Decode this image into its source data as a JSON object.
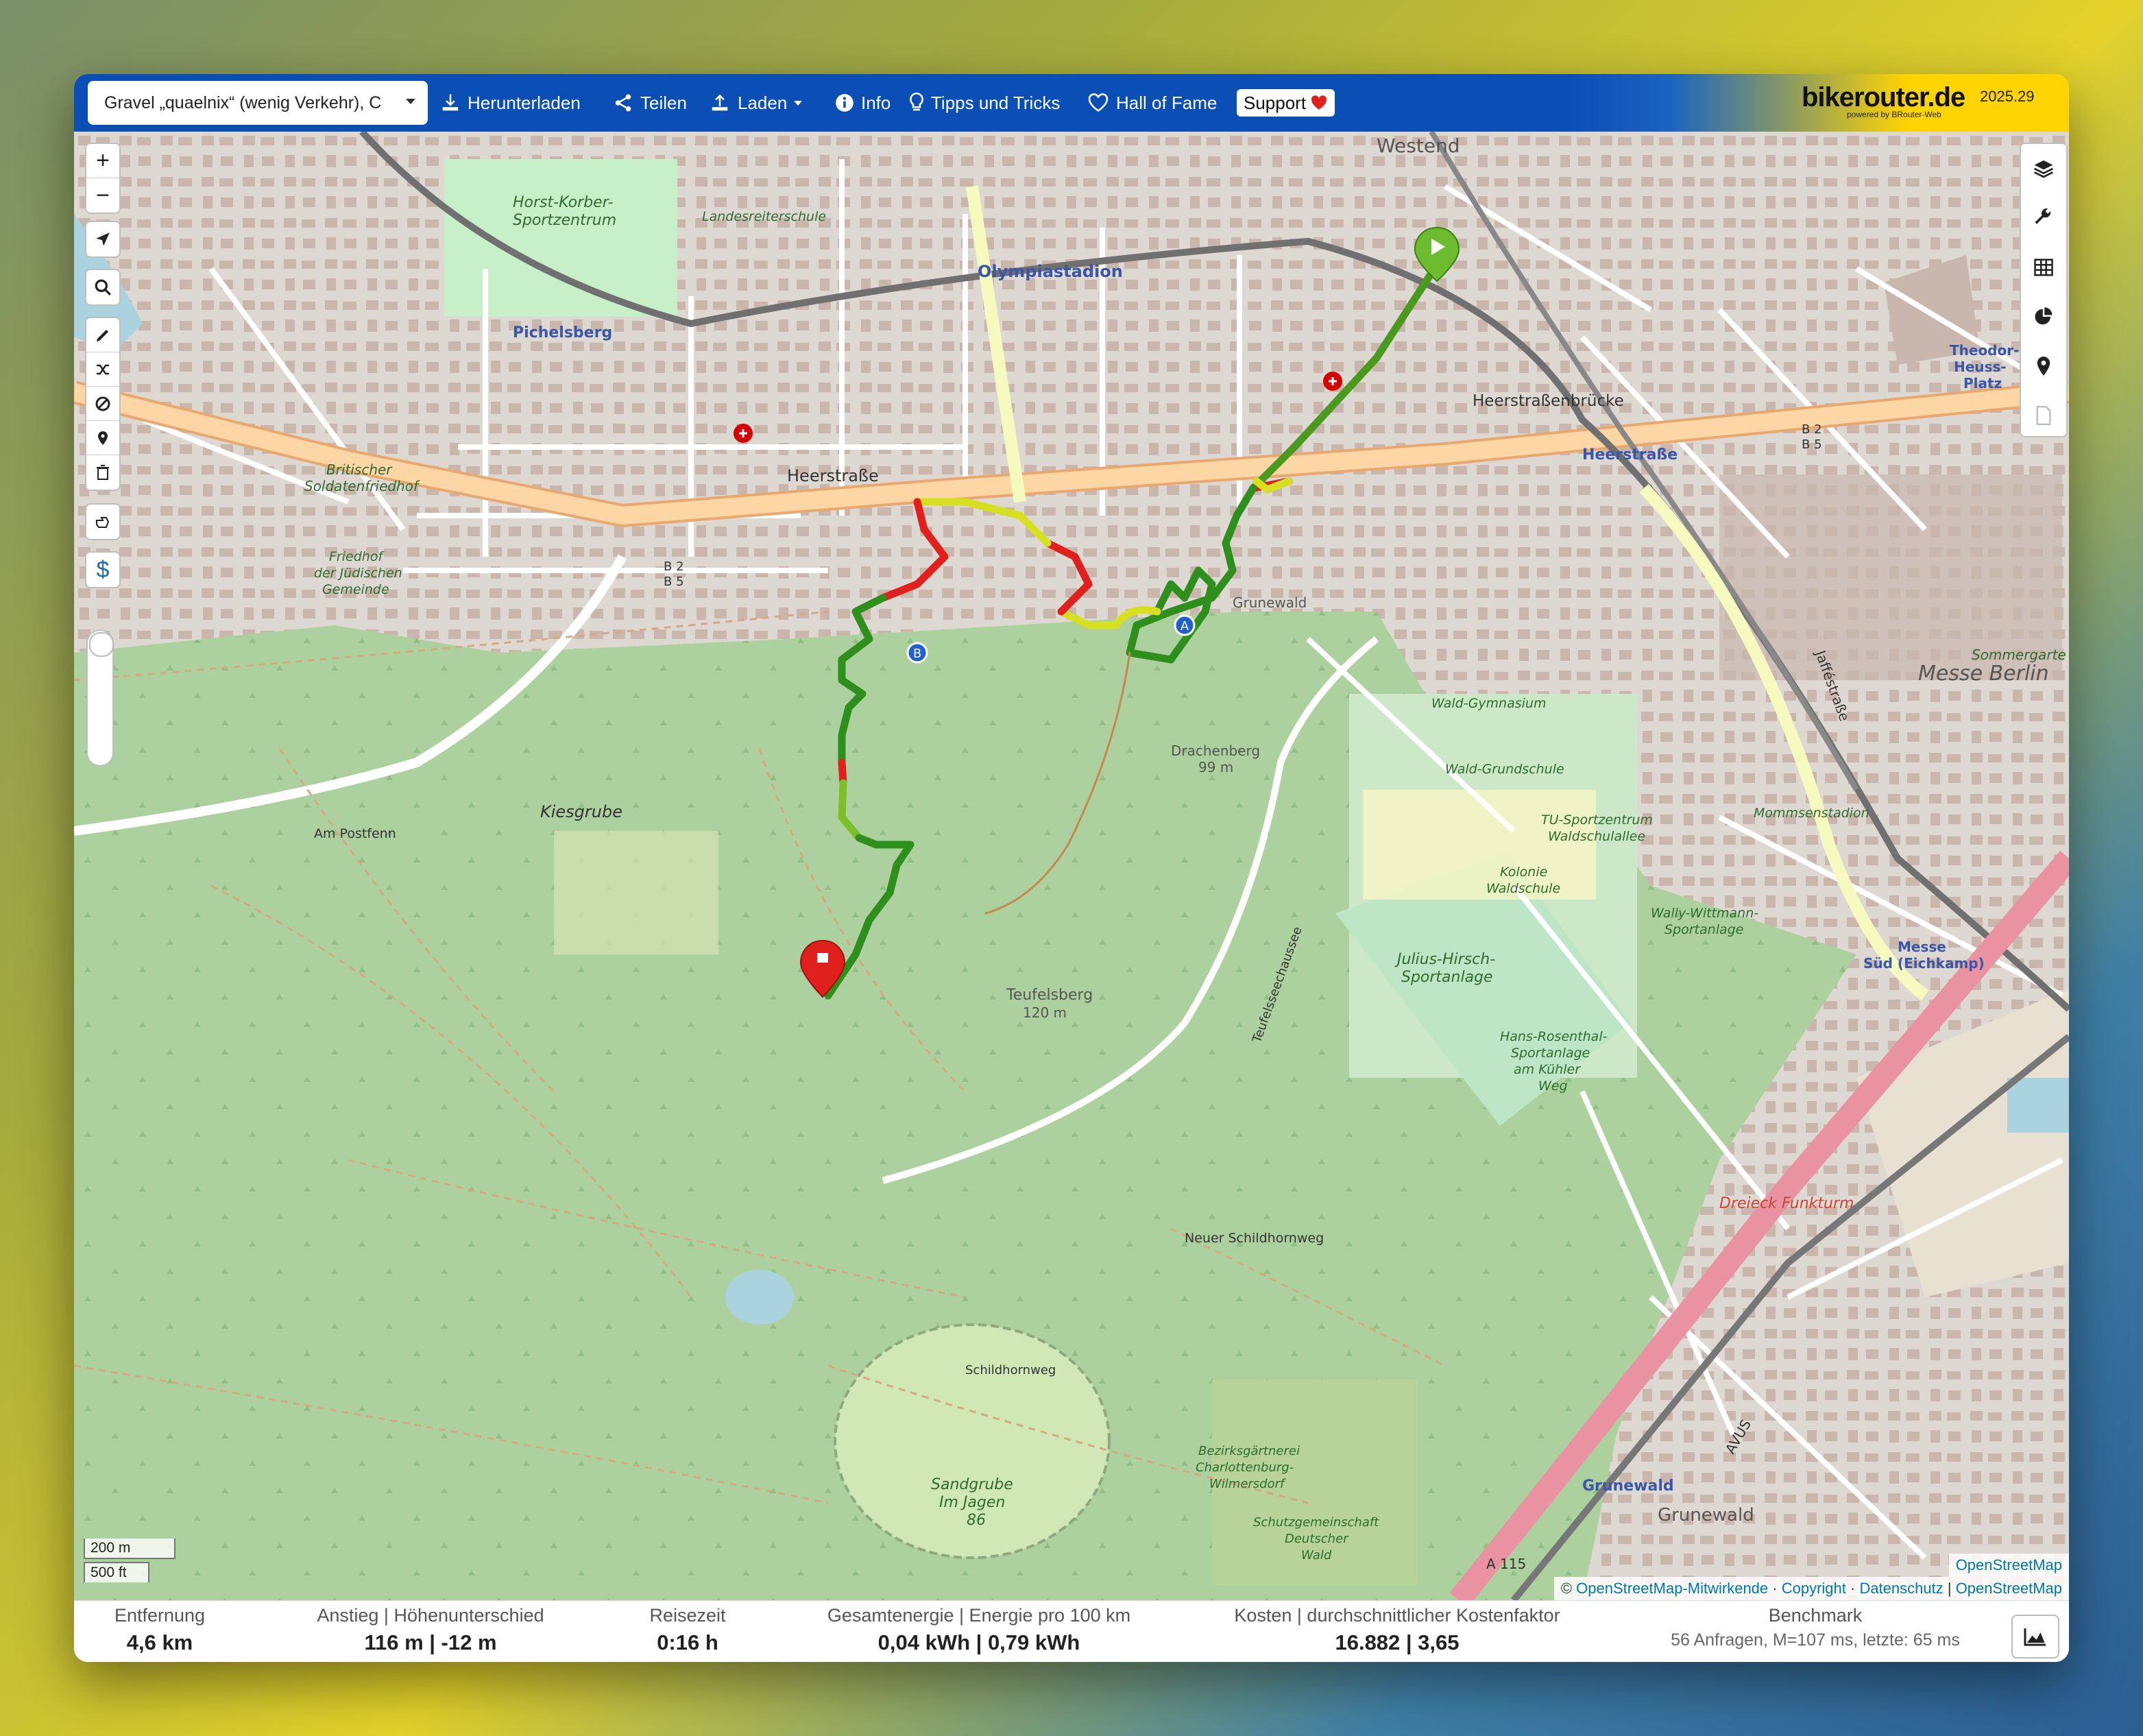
{
  "toolbar": {
    "profile": "Gravel „quaelnix“ (wenig Verkehr), C",
    "download": "Herunterladen",
    "share": "Teilen",
    "load": "Laden",
    "info": "Info",
    "tips": "Tipps und Tricks",
    "hall_of_fame": "Hall of Fame",
    "support": "Support",
    "brand": "bikerouter.de",
    "brand_sub": "powered by BRouter-Web",
    "version": "2025.29"
  },
  "map_controls": {
    "zoom_in": "+",
    "zoom_out": "−"
  },
  "map_labels": {
    "westend": "Westend",
    "olympiastadion": "Olympiastadion",
    "pichelsberg": "Pichelsberg",
    "horst_korber": "Horst-Korber-",
    "sportzentrum": "Sportzentrum",
    "landesreiterschule": "Landesreiterschule",
    "heerstrasse": "Heerstraße",
    "heerstrassenbruecke": "Heerstraßenbrücke",
    "heerstrasse_station": "Heerstraße",
    "britischer": "Britischer",
    "soldatenfriedhof": "Soldatenfriedhof",
    "friedhof": "Friedhof",
    "der_juedischen": "der Jüdischen",
    "gemeinde": "Gemeinde",
    "grunewald": "Grunewald",
    "kiesgrube": "Kiesgrube",
    "am_postfenn": "Am Postfenn",
    "drachenberg": "Drachenberg",
    "drachenberg_h": "99 m",
    "teufelsberg": "Teufelsberg",
    "teufelsberg_h": "120 m",
    "teufelsseechaussee": "Teufelsseechaussee",
    "wald_gymnasium": "Wald-Gymnasium",
    "wald_grundschule": "Wald-Grundschule",
    "tu_sportzentrum": "TU-Sportzentrum",
    "waldschulallee": "Waldschulallee",
    "kolonie": "Kolonie",
    "waldschule": "Waldschule",
    "mommsenstadion": "Mommsenstadion",
    "wally_wittmann": "Wally-Wittmann-",
    "sportanlage": "Sportanlage",
    "julius_hirsch": "Julius-Hirsch-",
    "hans_rosenthal": "Hans-Rosenthal-",
    "am_kuhler_weg": "am Kühler",
    "weg": "Weg",
    "messe_berlin": "Messe Berlin",
    "messe_sued": "Messe",
    "messe_sued2": "Süd (Eichkamp)",
    "theodor": "Theodor-",
    "heuss_platz": "Heuss-",
    "platz": "Platz",
    "avus": "AVUS",
    "a115": "A 115",
    "dreieck_funkturm": "Dreieck Funkturm",
    "neuer_schildhornweg": "Neuer Schildhornweg",
    "schildhornweg": "Schildhornweg",
    "sandgrube": "Sandgrube",
    "im_jagen": "Im Jagen",
    "jagen_86": "86",
    "bezirksgaertnerei": "Bezirksgärtnerei",
    "charlottenburg": "Charlottenburg-",
    "wilmersdorf": "Wilmersdorf",
    "schutzgemeinschaft": "Schutzgemeinschaft",
    "deutscher": "Deutscher",
    "wald": "Wald",
    "grunewald_station": "Grunewald",
    "grunewald_district": "Grunewald",
    "jaffestrasse": "Jafféstraße",
    "sommergarten": "Sommergarte",
    "b2": "B 2",
    "b5": "B 5",
    "marker_a": "A",
    "marker_b": "B"
  },
  "scale": {
    "metric": "200 m",
    "imperial": "500 ft"
  },
  "attribution": {
    "provider": "OpenStreetMap",
    "copy_sign": "©",
    "contributors": "OpenStreetMap-Mitwirkende",
    "copyright": "Copyright",
    "datenschutz": "Datenschutz",
    "osm": "OpenStreetMap"
  },
  "stats": {
    "distance_label": "Entfernung",
    "distance_value": "4,6 km",
    "ascent_label": "Anstieg | Höhenunterschied",
    "ascent_value": "116 m | -12 m",
    "time_label": "Reisezeit",
    "time_value": "0:16 h",
    "energy_label": "Gesamtenergie | Energie pro 100 km",
    "energy_value": "0,04 kWh | 0,79 kWh",
    "cost_label": "Kosten | durchschnittlicher Kostenfaktor",
    "cost_value": "16.882 | 3,65",
    "bench_label": "Benchmark",
    "bench_value": "56 Anfragen, M=107 ms, letzte: 65 ms"
  },
  "colors": {
    "toolbar_blue": "#0b4fb6",
    "route_green": "#2f8f1c",
    "route_red": "#e0201c",
    "route_yellow": "#d6e021",
    "forest": "#add19e",
    "road_major": "#fcd6a4"
  }
}
